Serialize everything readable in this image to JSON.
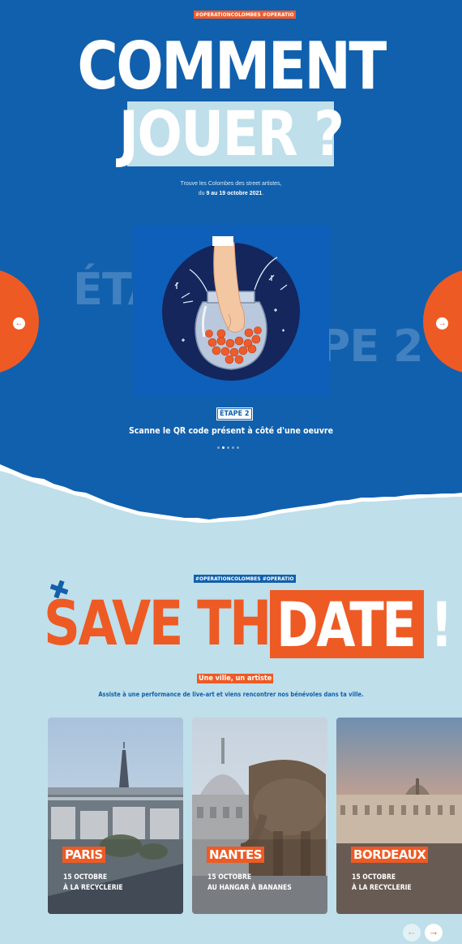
{
  "how_to": {
    "hashtag": "#OPERATIONCOLOMBES #OPERATIO",
    "title_line1": "COMMENT",
    "title_line2": "JOUER ?",
    "intro_line1": "Trouve les Colombes des street artistes,",
    "intro_prefix": "du",
    "intro_dates": "9 au 19 octobre 2021",
    "intro_suffix": ".",
    "ghost_left": "ÉTAPE",
    "ghost_right": "APE 2",
    "step_label": "ÉTAPE 2",
    "step_text": "Scanne le QR code présent à côté d'une oeuvre",
    "slides_count": 5,
    "active_slide": 2,
    "prev_icon": "←",
    "next_icon": "→"
  },
  "save_the_date": {
    "hashtag": "#OPERATIONCOLOMBES #OPERATIO",
    "title_part1": "SAVE THE",
    "title_part2": "DATE !",
    "subtitle_tag": "Une ville, un artiste",
    "description": "Assiste à une performance de live-art et viens rencontrer nos bénévoles dans ta ville.",
    "events": [
      {
        "city": "PARIS",
        "date": "15 OCTOBRE",
        "venue": "À LA RECYCLERIE"
      },
      {
        "city": "NANTES",
        "date": "15 OCTOBRE",
        "venue": "AU HANGAR À BANANES"
      },
      {
        "city": "BORDEAUX",
        "date": "15 OCTOBRE",
        "venue": "À LA RECYCLERIE"
      }
    ],
    "pager_prev": "←",
    "pager_next": "→"
  },
  "colors": {
    "blue": "#1160ad",
    "orange": "#ee5a24",
    "light_blue": "#bfdfea"
  }
}
